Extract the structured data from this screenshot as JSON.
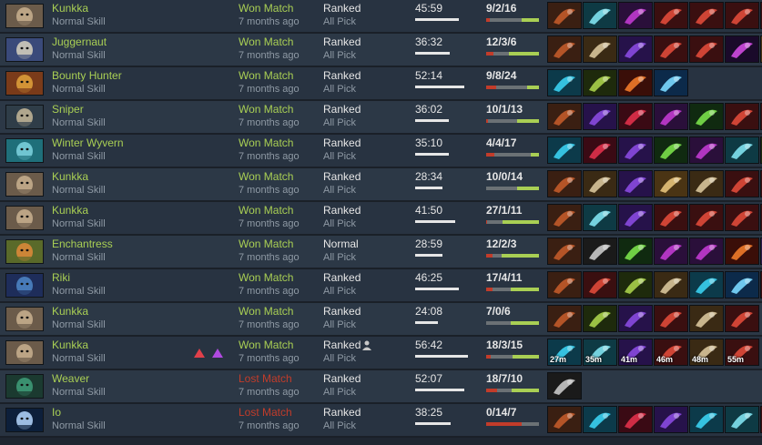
{
  "columns_hidden": true,
  "rows": [
    {
      "hero": "Kunkka",
      "skill": "Normal Skill",
      "result": "Won Match",
      "ago": "7 months ago",
      "lobby": "Ranked",
      "mode": "All Pick",
      "duration": "45:59",
      "duration_fraction": 0.82,
      "kda": "9/2/16",
      "k": 9,
      "d": 2,
      "a": 16,
      "items": [
        "boots-icon",
        "blink-icon",
        "bracer-icon",
        "dagger-icon",
        "dagger-icon",
        "dagger-icon",
        "dagger-icon"
      ],
      "item_times": []
    },
    {
      "hero": "Juggernaut",
      "skill": "Normal Skill",
      "result": "Won Match",
      "ago": "7 months ago",
      "lobby": "Ranked",
      "mode": "All Pick",
      "duration": "36:32",
      "duration_fraction": 0.65,
      "kda": "12/3/6",
      "k": 12,
      "d": 3,
      "a": 6,
      "items": [
        "boots-icon",
        "axe-icon",
        "staff-icon",
        "dagger-icon",
        "dagger-icon",
        "cross-icon",
        "scroll-icon"
      ],
      "item_times": []
    },
    {
      "hero": "Bounty Hunter",
      "skill": "Normal Skill",
      "result": "Won Match",
      "ago": "7 months ago",
      "lobby": "Ranked",
      "mode": "All Pick",
      "duration": "52:14",
      "duration_fraction": 0.93,
      "kda": "9/8/24",
      "k": 9,
      "d": 8,
      "a": 24,
      "items": [
        "orb-icon",
        "wand-icon",
        "flame-icon",
        "gem-icon"
      ],
      "item_times": []
    },
    {
      "hero": "Sniper",
      "skill": "Normal Skill",
      "result": "Won Match",
      "ago": "7 months ago",
      "lobby": "Ranked",
      "mode": "All Pick",
      "duration": "36:02",
      "duration_fraction": 0.64,
      "kda": "10/1/13",
      "k": 10,
      "d": 1,
      "a": 13,
      "items": [
        "boots-icon",
        "staff-icon",
        "mask-icon",
        "bracer-icon",
        "claw-icon",
        "dagger-icon",
        "dagger-icon"
      ],
      "item_times": []
    },
    {
      "hero": "Winter Wyvern",
      "skill": "Normal Skill",
      "result": "Won Match",
      "ago": "7 months ago",
      "lobby": "Ranked",
      "mode": "All Pick",
      "duration": "35:10",
      "duration_fraction": 0.63,
      "kda": "4/4/17",
      "k": 4,
      "d": 4,
      "a": 17,
      "items": [
        "orb-icon",
        "mask-icon",
        "staff-icon",
        "claw-icon",
        "bracer-icon",
        "blink-icon",
        "wand-icon"
      ],
      "item_times": []
    },
    {
      "hero": "Kunkka",
      "skill": "Normal Skill",
      "result": "Won Match",
      "ago": "7 months ago",
      "lobby": "Ranked",
      "mode": "All Pick",
      "duration": "28:34",
      "duration_fraction": 0.51,
      "kda": "10/0/14",
      "k": 10,
      "d": 0,
      "a": 14,
      "items": [
        "boots-icon",
        "axe-icon",
        "staff-icon",
        "scroll-icon",
        "axe-icon",
        "dagger-icon",
        "dagger-icon"
      ],
      "item_times": []
    },
    {
      "hero": "Kunkka",
      "skill": "Normal Skill",
      "result": "Won Match",
      "ago": "7 months ago",
      "lobby": "Ranked",
      "mode": "All Pick",
      "duration": "41:50",
      "duration_fraction": 0.75,
      "kda": "27/1/11",
      "k": 27,
      "d": 1,
      "a": 11,
      "items": [
        "boots-icon",
        "blink-icon",
        "staff-icon",
        "dagger-icon",
        "dagger-icon",
        "dagger-icon",
        "dagger-icon"
      ],
      "item_times": []
    },
    {
      "hero": "Enchantress",
      "skill": "Normal Skill",
      "result": "Won Match",
      "ago": "7 months ago",
      "lobby": "Normal",
      "mode": "All Pick",
      "duration": "28:59",
      "duration_fraction": 0.52,
      "kda": "12/2/3",
      "k": 12,
      "d": 2,
      "a": 3,
      "items": [
        "boots-icon",
        "fan-icon",
        "claw-icon",
        "bracer-icon",
        "bracer-icon",
        "flame-icon",
        "crystal-icon"
      ],
      "item_times": []
    },
    {
      "hero": "Riki",
      "skill": "Normal Skill",
      "result": "Won Match",
      "ago": "7 months ago",
      "lobby": "Ranked",
      "mode": "All Pick",
      "duration": "46:25",
      "duration_fraction": 0.83,
      "kda": "17/4/11",
      "k": 17,
      "d": 4,
      "a": 11,
      "items": [
        "boots-icon",
        "dagger-icon",
        "wand-icon",
        "axe-icon",
        "orb-icon",
        "gem-icon",
        "dagger-icon"
      ],
      "item_times": []
    },
    {
      "hero": "Kunkka",
      "skill": "Normal Skill",
      "result": "Won Match",
      "ago": "7 months ago",
      "lobby": "Ranked",
      "mode": "All Pick",
      "duration": "24:08",
      "duration_fraction": 0.43,
      "kda": "7/0/6",
      "k": 7,
      "d": 0,
      "a": 6,
      "items": [
        "boots-icon",
        "wand-icon",
        "staff-icon",
        "dagger-icon",
        "axe-icon",
        "dagger-icon"
      ],
      "item_times": []
    },
    {
      "hero": "Kunkka",
      "skill": "Normal Skill",
      "result": "Won Match",
      "ago": "7 months ago",
      "lobby": "Ranked",
      "mode": "All Pick",
      "duration": "56:42",
      "duration_fraction": 1.0,
      "kda": "18/3/15",
      "k": 18,
      "d": 3,
      "a": 15,
      "items": [
        "orb-icon",
        "blink-icon",
        "staff-icon",
        "dagger-icon",
        "axe-icon",
        "dagger-icon"
      ],
      "item_times": [
        "27m",
        "35m",
        "41m",
        "46m",
        "48m",
        "55m"
      ],
      "abilities": [
        "red-ability-icon",
        "purple-ability-icon"
      ],
      "party": true
    },
    {
      "hero": "Weaver",
      "skill": "Normal Skill",
      "result": "Lost Match",
      "ago": "7 months ago",
      "lobby": "Ranked",
      "mode": "All Pick",
      "duration": "52:07",
      "duration_fraction": 0.93,
      "kda": "18/7/10",
      "k": 18,
      "d": 7,
      "a": 10,
      "items": [
        "fan-icon"
      ],
      "item_times": []
    },
    {
      "hero": "Io",
      "skill": "Normal Skill",
      "result": "Lost Match",
      "ago": "7 months ago",
      "lobby": "Ranked",
      "mode": "All Pick",
      "duration": "38:25",
      "duration_fraction": 0.68,
      "kda": "0/14/7",
      "k": 0,
      "d": 14,
      "a": 7,
      "items": [
        "boots-icon",
        "orb-icon",
        "mask-icon",
        "staff-icon",
        "orb-icon",
        "blink-icon",
        "dagger-icon"
      ],
      "item_times": []
    }
  ],
  "colors": {
    "win": "#a9cf54",
    "loss": "#c23c2a",
    "hero": "#a9cf54",
    "muted": "#8f9aa5"
  }
}
